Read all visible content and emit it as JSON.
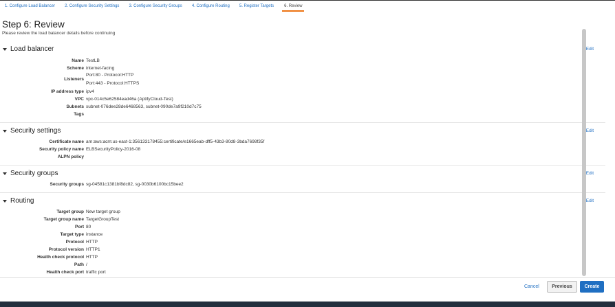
{
  "tabs": [
    {
      "label": "1. Configure Load Balancer"
    },
    {
      "label": "2. Configure Security Settings"
    },
    {
      "label": "3. Configure Security Groups"
    },
    {
      "label": "4. Configure Routing"
    },
    {
      "label": "5. Register Targets"
    },
    {
      "label": "6. Review"
    }
  ],
  "page": {
    "title": "Step 6: Review",
    "subtitle": "Please review the load balancer details before continuing"
  },
  "sections": {
    "load_balancer": {
      "title": "Load balancer",
      "edit": "Edit",
      "rows": {
        "name": {
          "k": "Name",
          "v": "TestLB"
        },
        "scheme": {
          "k": "Scheme",
          "v": "internet-facing"
        },
        "listeners": {
          "k": "Listeners",
          "v1": "Port:80 - Protocol:HTTP",
          "v2": "Port:443 - Protocol:HTTPS"
        },
        "ip": {
          "k": "IP address type",
          "v": "ipv4"
        },
        "vpc": {
          "k": "VPC",
          "v": "vpc-014c5e62584ead46a (AptifyCloud-Test)"
        },
        "subnets": {
          "k": "Subnets",
          "v": "subnet-076dee28de6468563, subnet-090de7a9f210d7c75"
        },
        "tags": {
          "k": "Tags",
          "v": ""
        }
      }
    },
    "security_settings": {
      "title": "Security settings",
      "edit": "Edit",
      "rows": {
        "cert": {
          "k": "Certificate name",
          "v": "arn:aws:acm:us-east-1:356133178455:certificate/e1665eab-dff5-43b3-80d8-3bda7698f35f"
        },
        "policy": {
          "k": "Security policy name",
          "v": "ELBSecurityPolicy-2016-08"
        },
        "alpn": {
          "k": "ALPN policy",
          "v": ""
        }
      }
    },
    "security_groups": {
      "title": "Security groups",
      "edit": "Edit",
      "rows": {
        "groups": {
          "k": "Security groups",
          "v": "sg-04581c1381bf8dc82, sg-0030b6100bc15bee2"
        }
      }
    },
    "routing": {
      "title": "Routing",
      "edit": "Edit",
      "rows": {
        "tg": {
          "k": "Target group",
          "v": "New target group"
        },
        "tgname": {
          "k": "Target group name",
          "v": "TargetGroupTest"
        },
        "port": {
          "k": "Port",
          "v": "80"
        },
        "ttype": {
          "k": "Target type",
          "v": "instance"
        },
        "protocol": {
          "k": "Protocol",
          "v": "HTTP"
        },
        "pver": {
          "k": "Protocol version",
          "v": "HTTP1"
        },
        "hcp": {
          "k": "Health check protocol",
          "v": "HTTP"
        },
        "path": {
          "k": "Path",
          "v": "/"
        },
        "hcport": {
          "k": "Health check port",
          "v": "traffic port"
        }
      }
    }
  },
  "footer": {
    "cancel": "Cancel",
    "previous": "Previous",
    "create": "Create"
  }
}
